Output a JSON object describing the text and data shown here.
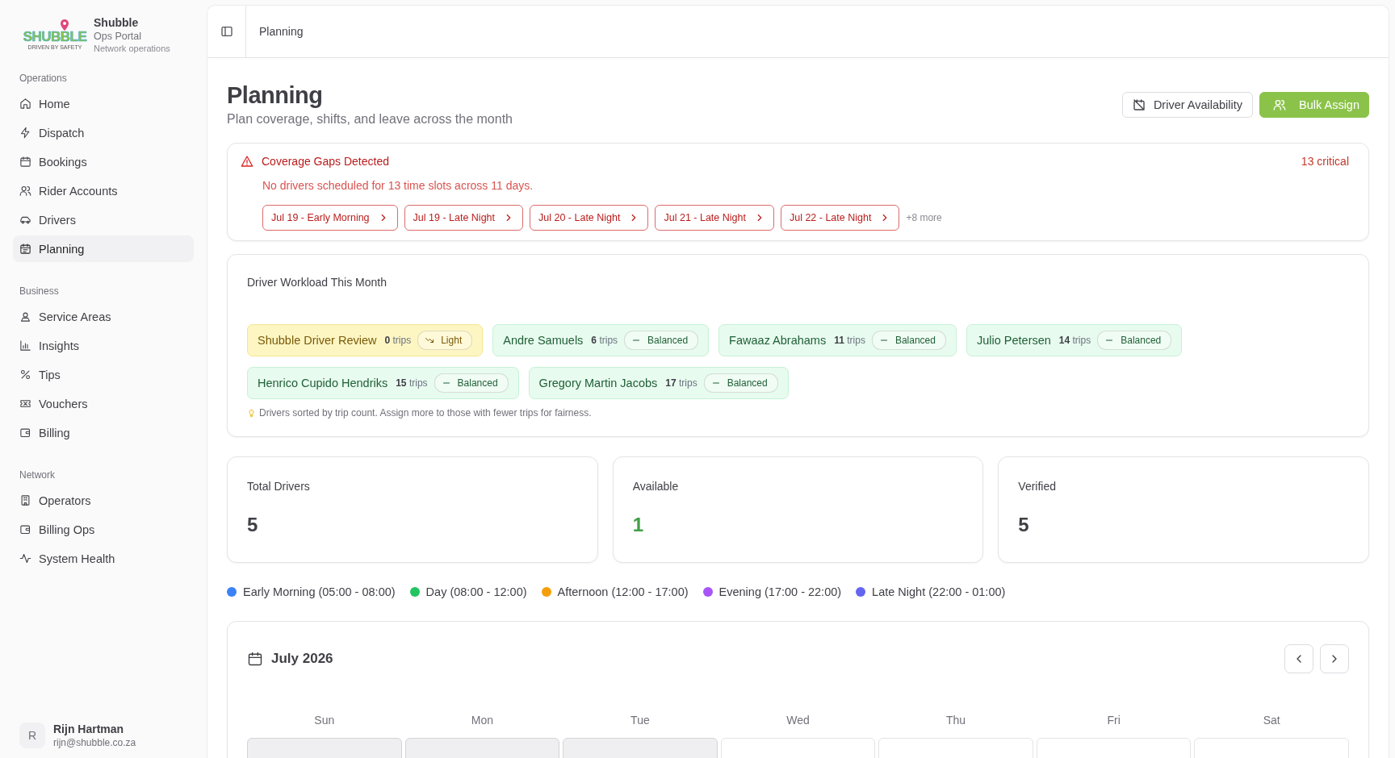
{
  "brand": {
    "logo_text": "SHUBBLE",
    "logo_tagline": "DRIVEN BY SAFETY",
    "name": "Shubble",
    "subtitle": "Ops Portal",
    "caption": "Network operations"
  },
  "sidebar": {
    "groups": [
      {
        "label": "Operations",
        "items": [
          {
            "label": "Home",
            "selected": false
          },
          {
            "label": "Dispatch",
            "selected": false
          },
          {
            "label": "Bookings",
            "selected": false
          },
          {
            "label": "Rider Accounts",
            "selected": false
          },
          {
            "label": "Drivers",
            "selected": false
          },
          {
            "label": "Planning",
            "selected": true
          }
        ]
      },
      {
        "label": "Business",
        "items": [
          {
            "label": "Service Areas",
            "selected": false
          },
          {
            "label": "Insights",
            "selected": false
          },
          {
            "label": "Tips",
            "selected": false
          },
          {
            "label": "Vouchers",
            "selected": false
          },
          {
            "label": "Billing",
            "selected": false
          }
        ]
      },
      {
        "label": "Network",
        "items": [
          {
            "label": "Operators",
            "selected": false
          },
          {
            "label": "Billing Ops",
            "selected": false
          },
          {
            "label": "System Health",
            "selected": false
          }
        ]
      }
    ]
  },
  "user": {
    "initial": "R",
    "name": "Rijn Hartman",
    "email": "rijn@shubble.co.za"
  },
  "breadcrumb": "Planning",
  "page": {
    "title": "Planning",
    "subtitle": "Plan coverage, shifts, and leave across the month",
    "buttons": [
      {
        "label": "Driver Availability",
        "kind": "outline"
      },
      {
        "label": "Bulk Assign",
        "kind": "primary"
      }
    ]
  },
  "alert": {
    "title": "Coverage Gaps Detected",
    "count": "13 critical",
    "message": "No drivers scheduled for 13 time slots across 11 days.",
    "gaps": [
      "Jul 19 - Early Morning",
      "Jul 19 - Late Night",
      "Jul 20 - Late Night",
      "Jul 21 - Late Night",
      "Jul 22 - Late Night"
    ],
    "more": "+8 more"
  },
  "workload": {
    "title": "Driver Workload This Month",
    "drivers": [
      {
        "name": "Shubble Driver Review",
        "count": "0",
        "unit": "trips",
        "status": "Light",
        "kind": "light"
      },
      {
        "name": "Andre Samuels",
        "count": "6",
        "unit": "trips",
        "status": "Balanced",
        "kind": "balanced"
      },
      {
        "name": "Fawaaz Abrahams",
        "count": "11",
        "unit": "trips",
        "status": "Balanced",
        "kind": "balanced"
      },
      {
        "name": "Julio Petersen",
        "count": "14",
        "unit": "trips",
        "status": "Balanced",
        "kind": "balanced"
      },
      {
        "name": "Henrico Cupido Hendriks",
        "count": "15",
        "unit": "trips",
        "status": "Balanced",
        "kind": "balanced"
      },
      {
        "name": "Gregory Martin Jacobs",
        "count": "17",
        "unit": "trips",
        "status": "Balanced",
        "kind": "balanced"
      }
    ],
    "note": "Drivers sorted by trip count. Assign more to those with fewer trips for fairness."
  },
  "stats": [
    {
      "label": "Total Drivers",
      "value": "5",
      "kind": "neutral"
    },
    {
      "label": "Available",
      "value": "1",
      "kind": "positive"
    },
    {
      "label": "Verified",
      "value": "5",
      "kind": "neutral"
    }
  ],
  "legend": [
    {
      "label": "Early Morning (05:00 - 08:00)",
      "color": "#3b82f6"
    },
    {
      "label": "Day (08:00 - 12:00)",
      "color": "#22c55e"
    },
    {
      "label": "Afternoon (12:00 - 17:00)",
      "color": "#f59e0b"
    },
    {
      "label": "Evening (17:00 - 22:00)",
      "color": "#a855f7"
    },
    {
      "label": "Late Night (22:00 - 01:00)",
      "color": "#6366f1"
    }
  ],
  "calendar": {
    "month": "July 2026",
    "weekdays": [
      "Sun",
      "Mon",
      "Tue",
      "Wed",
      "Thu",
      "Fri",
      "Sat"
    ],
    "cells": [
      {
        "kind": "blank"
      },
      {
        "kind": "blank"
      },
      {
        "kind": "blank"
      },
      {
        "kind": "day"
      },
      {
        "kind": "day"
      },
      {
        "kind": "day"
      },
      {
        "kind": "day"
      }
    ]
  }
}
